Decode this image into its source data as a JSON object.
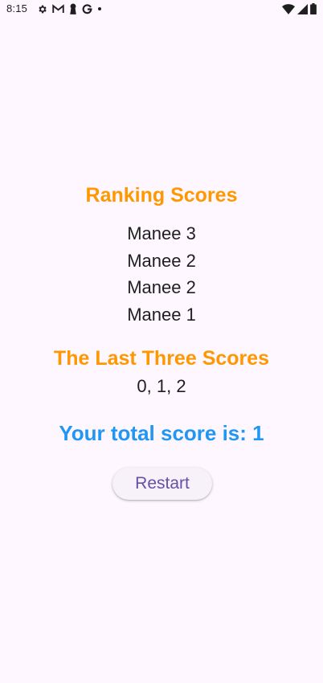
{
  "status_bar": {
    "time": "8:15",
    "left_icons": [
      "settings-icon",
      "gmail-icon",
      "keyhole-icon",
      "google-icon",
      "dot-icon"
    ],
    "right_icons": [
      "wifi-icon",
      "signal-icon",
      "battery-icon"
    ]
  },
  "ranking": {
    "title": "Ranking Scores",
    "items": [
      "Manee 3",
      "Manee 2",
      "Manee 2",
      "Manee 1"
    ]
  },
  "last_three": {
    "title": "The Last Three Scores",
    "scores": "0, 1, 2"
  },
  "total": {
    "text": "Your total score is: 1"
  },
  "actions": {
    "restart_label": "Restart"
  },
  "colors": {
    "background": "#fef7ff",
    "heading_orange": "#ff9800",
    "total_blue": "#2196f3",
    "button_text": "#6750a4",
    "button_bg": "#f7f2fa"
  }
}
